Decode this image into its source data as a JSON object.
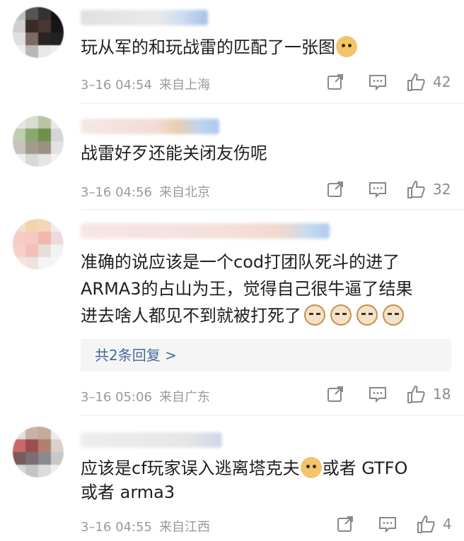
{
  "comments": [
    {
      "text": "玩从军的和玩战雷的匹配了一张图",
      "emoji_after": [
        "doge"
      ],
      "time": "3–16 04:54",
      "location": "来自上海",
      "likes": "42"
    },
    {
      "text": "战雷好歹还能关闭友伤呢",
      "emoji_after": [],
      "time": "3–16 04:56",
      "location": "来自北京",
      "likes": "32"
    },
    {
      "text_lines": [
        "准确的说应该是一个cod打团队死斗的进了",
        "ARMA3的占山为王，觉得自己很牛逼了结果",
        "进去啥人都见不到就被打死了"
      ],
      "emoji_after": [
        "cat",
        "cat",
        "cat",
        "cat"
      ],
      "replies": "共2条回复 >",
      "time": "3–16 05:06",
      "location": "来自广东",
      "likes": "18"
    },
    {
      "text_part1": "应该是cf玩家误入逃离塔克夫",
      "text_part2": "或者 GTFO",
      "text_line2": "或者 arma3",
      "emoji_after": [
        "doge"
      ],
      "time": "3–16 04:55",
      "location": "来自江西",
      "likes": "4"
    }
  ],
  "icons": {
    "share": "share-icon",
    "comment": "comment-icon",
    "like": "thumbs-up-icon"
  },
  "colors": {
    "reply_link": "#46699a",
    "meta": "#9a9a9a"
  }
}
